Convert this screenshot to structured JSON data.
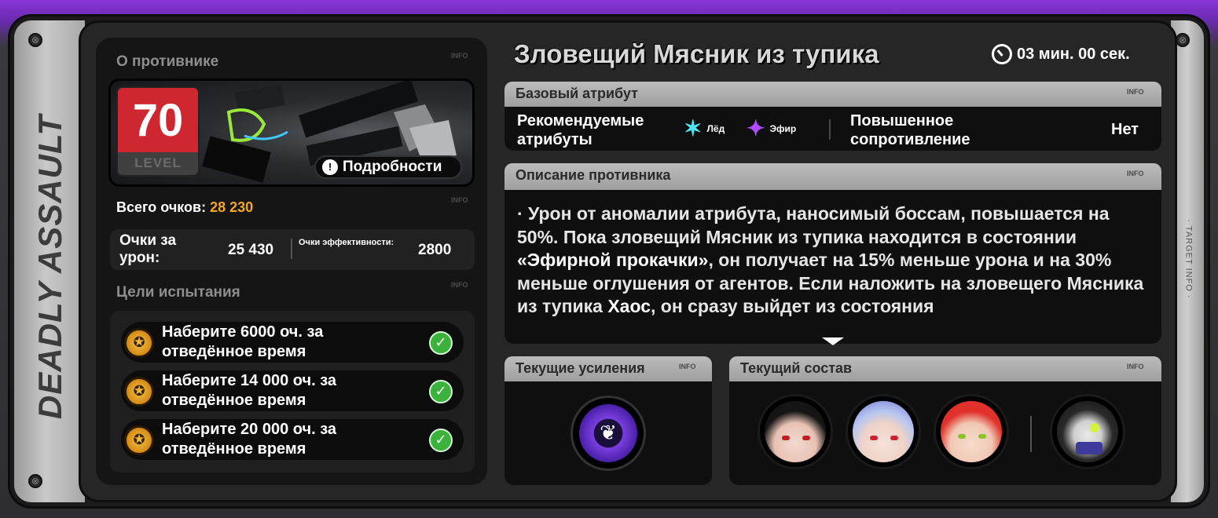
{
  "brand": "DEADLY ASSAULT",
  "side_label": "· TARGET INFO ·",
  "info_tag": "INFO",
  "enemy": {
    "section_title": "О противнике",
    "level": "70",
    "level_label": "LEVEL",
    "details_button": "Подробности",
    "name": "Зловещий Мясник из тупика"
  },
  "timer": {
    "text": "03 мин. 00 сек.",
    "icon": "stopwatch-icon"
  },
  "scores": {
    "total_label": "Всего очков:",
    "total_value": "28 230",
    "damage_label": "Очки за урон:",
    "damage_value": "25 430",
    "efficiency_label": "Очки эффективности:",
    "efficiency_value": "2800"
  },
  "goals": {
    "section_title": "Цели испытания",
    "items": [
      {
        "text": "Наберите 6000 оч. за отведённое время",
        "done": true
      },
      {
        "text": "Наберите 14 000 оч. за отведённое время",
        "done": true
      },
      {
        "text": "Наберите 20 000 оч. за отведённое время",
        "done": true
      }
    ]
  },
  "attributes": {
    "section_title": "Базовый атрибут",
    "recommended_label": "Рекомендуемые атрибуты",
    "recommended": [
      {
        "name": "Лёд",
        "icon": "ice-icon",
        "color": "#4fe6f0"
      },
      {
        "name": "Эфир",
        "icon": "ether-icon",
        "color": "#b24bff"
      }
    ],
    "resistance_label": "Повышенное сопротивление",
    "resistance_value": "Нет"
  },
  "description": {
    "section_title": "Описание противника",
    "text_before": "· Урон от аномалии атрибута, наносимый боссам, повышается на 50%. Пока зловещий Мясник из тупика находится в состоянии ",
    "highlight1": "«Эфирной прокачки»",
    "text_middle": ", он получает на 15% меньше урона и на 30% меньше оглушения от агентов. Если наложить на зловещего Мясника из тупика ",
    "highlight2": "Хаос",
    "text_after": ", он сразу выйдет из состояния"
  },
  "buffs": {
    "section_title": "Текущие усиления",
    "icon": "ether-buff-icon"
  },
  "team": {
    "section_title": "Текущий состав",
    "members": [
      "agent-1",
      "agent-2",
      "agent-3"
    ],
    "bangboo": "bangboo"
  },
  "colors": {
    "accent_orange": "#f5a623",
    "level_red": "#cf2730",
    "check_green": "#3bb23b"
  }
}
